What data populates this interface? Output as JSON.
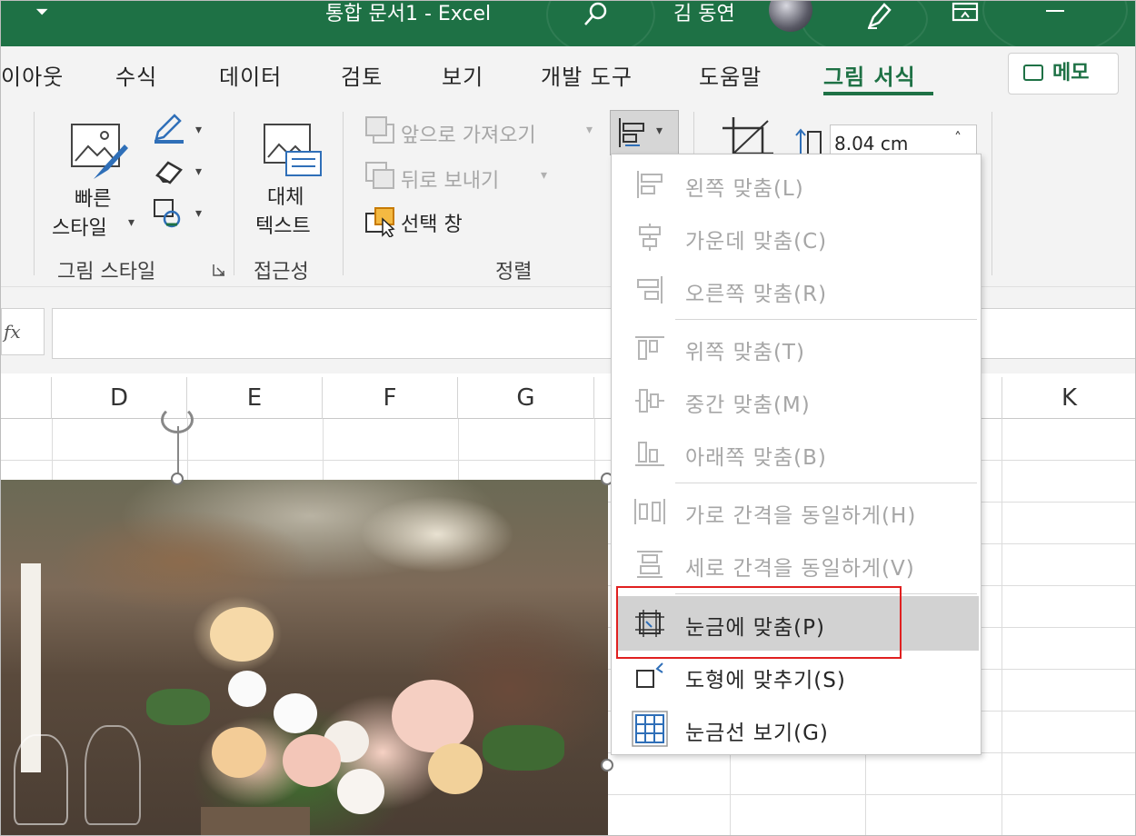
{
  "titlebar": {
    "quick_access_caret": "⏷",
    "document_title": "통합 문서1  -  Excel",
    "user_name": "김 동연",
    "bg_color": "#1e7145"
  },
  "tabs": [
    {
      "label": "이아웃"
    },
    {
      "label": "수식"
    },
    {
      "label": "데이터"
    },
    {
      "label": "검토"
    },
    {
      "label": "보기"
    },
    {
      "label": "개발 도구"
    },
    {
      "label": "도움말"
    },
    {
      "label": "그림 서식",
      "active": true
    }
  ],
  "memo_button": {
    "label": "메모"
  },
  "ribbon": {
    "picture_styles": {
      "quick_styles_line1": "빠른",
      "quick_styles_line2": "스타일",
      "group_label": "그림 스타일"
    },
    "accessibility": {
      "alt_text_line1": "대체",
      "alt_text_line2": "텍스트",
      "group_label": "접근성"
    },
    "arrange": {
      "bring_forward": "앞으로 가져오기",
      "send_backward": "뒤로 보내기",
      "selection_pane": "선택 창",
      "group_label": "정렬"
    },
    "size": {
      "height_value": "8.04 cm"
    }
  },
  "formula_bar": {
    "fx_label": "fx",
    "value": ""
  },
  "columns": [
    "D",
    "E",
    "F",
    "G",
    "K"
  ],
  "align_menu": {
    "items": [
      {
        "label": "왼쪽 맞춤(L)",
        "icon": "align-left-icon",
        "enabled": false
      },
      {
        "label": "가운데 맞춤(C)",
        "icon": "align-center-icon",
        "enabled": false
      },
      {
        "label": "오른쪽 맞춤(R)",
        "icon": "align-right-icon",
        "enabled": false
      },
      {
        "label": "위쪽 맞춤(T)",
        "icon": "align-top-icon",
        "enabled": false
      },
      {
        "label": "중간 맞춤(M)",
        "icon": "align-middle-icon",
        "enabled": false
      },
      {
        "label": "아래쪽 맞춤(B)",
        "icon": "align-bottom-icon",
        "enabled": false
      },
      {
        "label": "가로 간격을 동일하게(H)",
        "icon": "distribute-horizontal-icon",
        "enabled": false
      },
      {
        "label": "세로 간격을 동일하게(V)",
        "icon": "distribute-vertical-icon",
        "enabled": false
      },
      {
        "label": "눈금에 맞춤(P)",
        "icon": "snap-to-grid-icon",
        "enabled": true,
        "highlighted": true
      },
      {
        "label": "도형에 맞추기(S)",
        "icon": "snap-to-shape-icon",
        "enabled": true
      },
      {
        "label": "눈금선 보기(G)",
        "icon": "view-gridlines-icon",
        "enabled": true
      }
    ]
  },
  "colors": {
    "accent": "#1e7145",
    "annotation_box": "#e02020",
    "highlight": "#d2d2d2"
  }
}
